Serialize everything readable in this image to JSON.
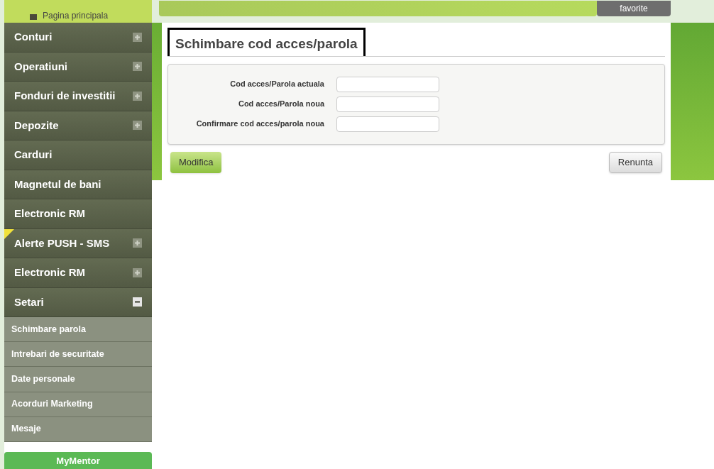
{
  "header": {
    "home_link": "Pagina principala",
    "favorites_button": "favorite"
  },
  "sidebar": {
    "items": [
      {
        "label": "Conturi",
        "kind": "collapsed",
        "flagged": false
      },
      {
        "label": "Operatiuni",
        "kind": "collapsed",
        "flagged": false
      },
      {
        "label": "Fonduri de investitii",
        "kind": "collapsed",
        "flagged": false
      },
      {
        "label": "Depozite",
        "kind": "collapsed",
        "flagged": false
      },
      {
        "label": "Carduri",
        "kind": "link",
        "flagged": false
      },
      {
        "label": "Magnetul de bani",
        "kind": "link",
        "flagged": false
      },
      {
        "label": "Electronic RM",
        "kind": "link",
        "flagged": false
      },
      {
        "label": "Alerte PUSH - SMS",
        "kind": "collapsed",
        "flagged": true
      },
      {
        "label": "Electronic RM",
        "kind": "collapsed",
        "flagged": false
      },
      {
        "label": "Setari",
        "kind": "expanded",
        "flagged": false,
        "children": [
          "Schimbare parola",
          "Intrebari de securitate",
          "Date personale",
          "Acorduri Marketing",
          "Mesaje"
        ]
      }
    ],
    "mentor_button": "MyMentor"
  },
  "form": {
    "title": "Schimbare cod acces/parola",
    "fields": [
      {
        "label": "Cod acces/Parola actuala"
      },
      {
        "label": "Cod acces/Parola noua"
      },
      {
        "label": "Confirmare cod acces/parola noua"
      }
    ],
    "submit_button": "Modifica",
    "cancel_button": "Renunta"
  }
}
